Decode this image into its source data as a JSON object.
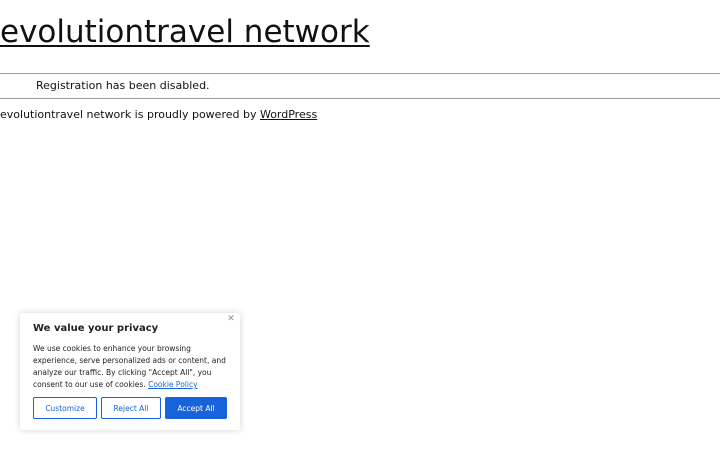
{
  "header": {
    "site_title": "evolutiontravel network"
  },
  "main": {
    "notice": "Registration has been disabled."
  },
  "footer": {
    "text_prefix": "evolutiontravel network is proudly powered by ",
    "link_label": "WordPress"
  },
  "cookie_banner": {
    "title": "We value your privacy",
    "body": "We use cookies to enhance your browsing experience, serve personalized ads or content, and analyze our traffic. By clicking \"Accept All\", you consent to our use of cookies.",
    "policy_link": "Cookie Policy",
    "close_icon": "close-icon",
    "customize_label": "Customize",
    "reject_label": "Reject All",
    "accept_label": "Accept All",
    "accent_color": "#1863dc"
  }
}
